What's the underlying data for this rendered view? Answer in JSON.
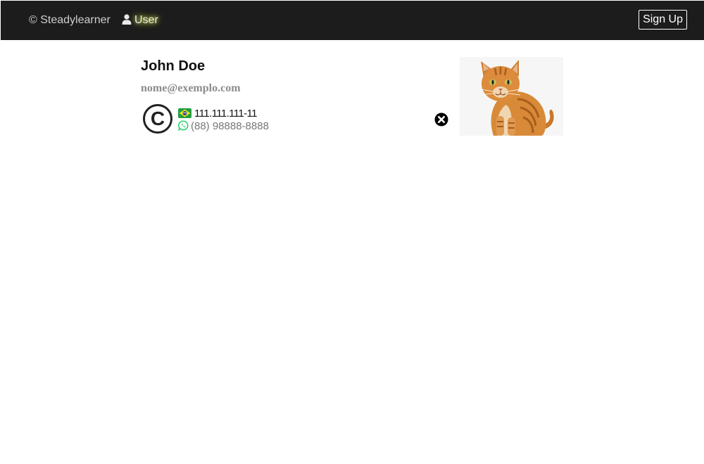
{
  "navbar": {
    "brand": "© Steadylearner",
    "user_link": "User",
    "user_icon": "user-icon",
    "signup_label": "Sign Up"
  },
  "profile": {
    "name": "John Doe",
    "email": "nome@exemplo.com",
    "id_number": "111.111.111-11",
    "whatsapp_number": "(88) 98888-8888",
    "badge_icon": "copyright-icon",
    "flag_icon": "brazil-flag-icon",
    "phone_icon": "whatsapp-icon",
    "remove_icon": "close-circle-icon",
    "photo": "cat-photo"
  },
  "colors": {
    "navbar_bg": "#1c1c1c",
    "user_glow": "#d7e85a",
    "whatsapp_green": "#25d366",
    "email_gray": "#8c8c8c"
  }
}
